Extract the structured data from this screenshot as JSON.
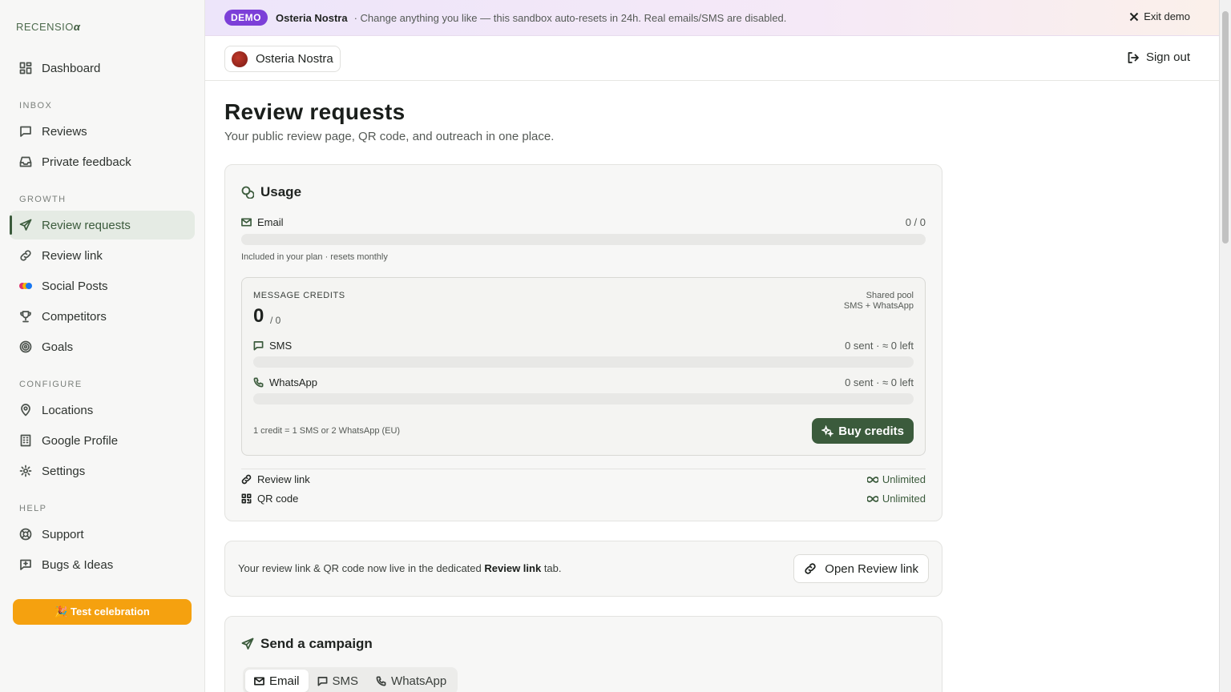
{
  "brand": {
    "logo_text": "RECENSIO",
    "logo_mark": "α"
  },
  "sidebar": {
    "dashboard": "Dashboard",
    "sections": {
      "inbox": "INBOX",
      "growth": "GROWTH",
      "configure": "CONFIGURE",
      "help": "HELP"
    },
    "items": {
      "reviews": "Reviews",
      "private_feedback": "Private feedback",
      "review_requests": "Review requests",
      "review_link": "Review link",
      "social_posts": "Social Posts",
      "competitors": "Competitors",
      "goals": "Goals",
      "locations": "Locations",
      "google_profile": "Google Profile",
      "settings": "Settings",
      "support": "Support",
      "bugs_ideas": "Bugs & Ideas"
    },
    "test_celebration": "🎉 Test celebration"
  },
  "banner": {
    "badge": "DEMO",
    "org": "Osteria Nostra",
    "message": "· Change anything you like — this sandbox auto-resets in 24h. Real emails/SMS are disabled.",
    "exit": "Exit demo"
  },
  "topbar": {
    "org": "Osteria Nostra",
    "sign_out": "Sign out"
  },
  "page": {
    "title": "Review requests",
    "subtitle": "Your public review page, QR code, and outreach in one place."
  },
  "usage": {
    "title": "Usage",
    "email_label": "Email",
    "email_value": "0 / 0",
    "email_progress": 0,
    "email_note": "Included in your plan · resets monthly",
    "credits": {
      "label": "MESSAGE CREDITS",
      "count": "0",
      "total": "/ 0",
      "pool_line1": "Shared pool",
      "pool_line2": "SMS + WhatsApp",
      "sms_label": "SMS",
      "sms_value": "0 sent · ≈ 0 left",
      "sms_progress": 0,
      "whatsapp_label": "WhatsApp",
      "whatsapp_value": "0 sent · ≈ 0 left",
      "whatsapp_progress": 0,
      "note": "1 credit = 1 SMS or 2 WhatsApp (EU)",
      "buy": "Buy credits"
    },
    "review_link_label": "Review link",
    "review_link_value": "Unlimited",
    "qr_label": "QR code",
    "qr_value": "Unlimited"
  },
  "link_notice": {
    "prefix": "Your review link & QR code now live in the dedicated",
    "bold": "Review link",
    "suffix": "tab.",
    "button": "Open Review link"
  },
  "campaign": {
    "title": "Send a campaign",
    "tabs": [
      "Email",
      "SMS",
      "WhatsApp"
    ]
  },
  "colors": {
    "accent": "#3b5b3c",
    "demo": "#7c3fd8",
    "celebrate": "#f5a10f"
  }
}
